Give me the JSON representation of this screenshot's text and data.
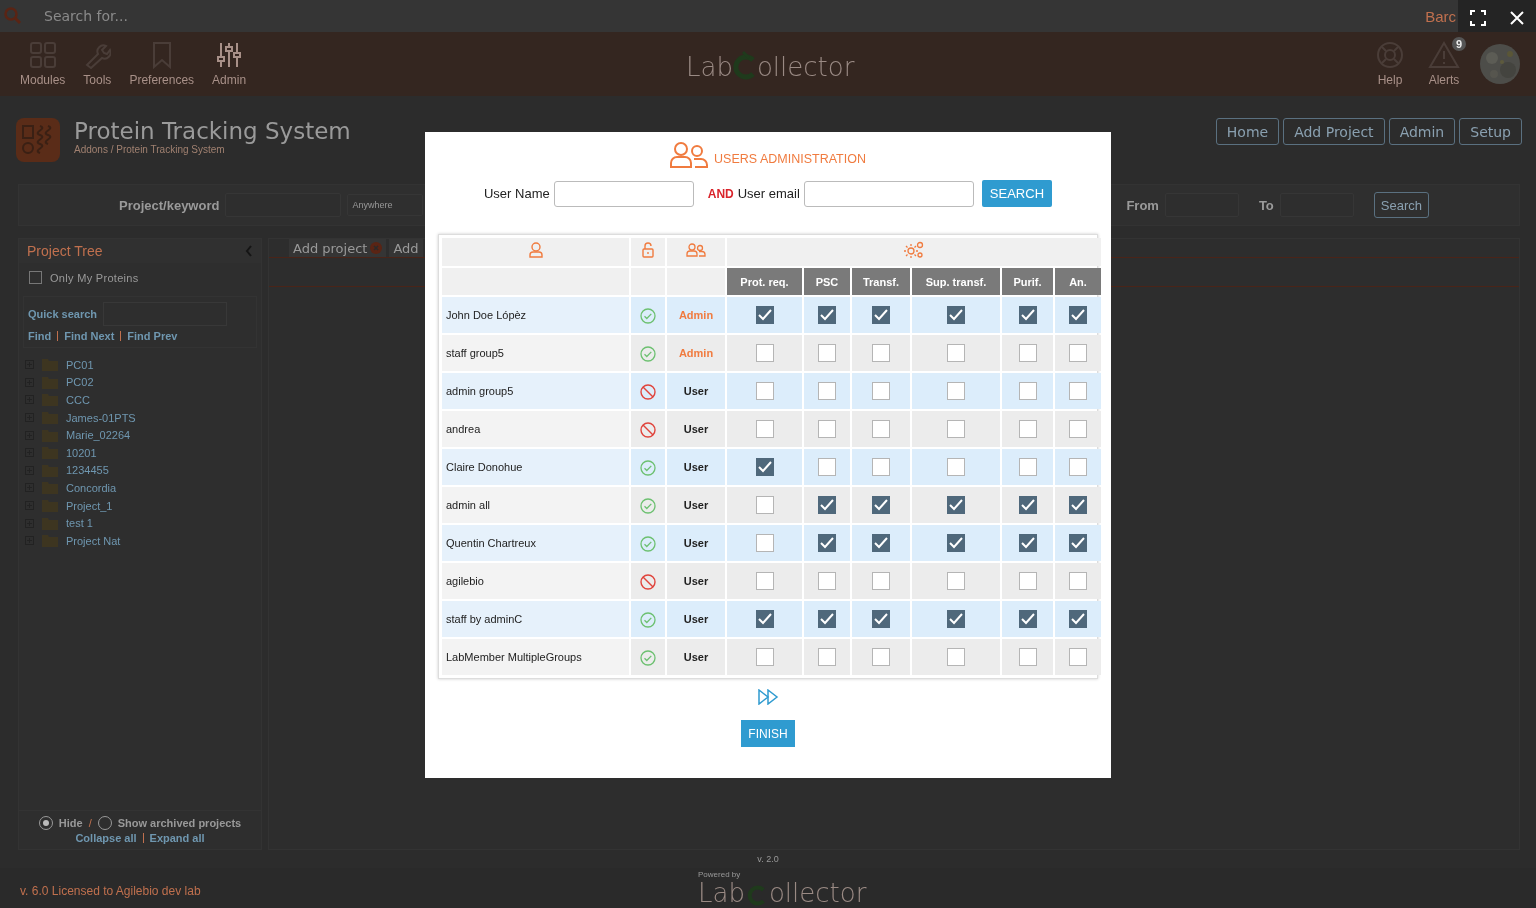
{
  "top_bar": {
    "search_placeholder": "Search for...",
    "barcode_label": "Barc"
  },
  "nav": [
    {
      "label": "Modules"
    },
    {
      "label": "Tools"
    },
    {
      "label": "Preferences"
    },
    {
      "label": "Admin"
    }
  ],
  "logo": {
    "left": "Lab",
    "right": "ollector"
  },
  "header_right": {
    "help": "Help",
    "alerts": "Alerts",
    "alert_count": "9"
  },
  "page": {
    "title": "Protein Tracking System",
    "breadcrumb": "Addons / Protein Tracking System"
  },
  "page_buttons": [
    "Home",
    "Add Project",
    "Admin",
    "Setup"
  ],
  "filter": {
    "keyword_label": "Project/keyword",
    "scope": "Anywhere",
    "from_label": "From",
    "to_label": "To",
    "search_button": "Search"
  },
  "project_tree": {
    "title": "Project Tree",
    "only_mine": {
      "label": "Only My Proteins",
      "checked": false
    },
    "quick_search_label": "Quick search",
    "find_links": [
      "Find",
      "Find Next",
      "Find Prev"
    ],
    "items": [
      {
        "label": "PC01",
        "expanded": false
      },
      {
        "label": "PC02",
        "expanded": false
      },
      {
        "label": "CCC",
        "expanded": false
      },
      {
        "label": "James-01PTS",
        "expanded": false
      },
      {
        "label": "Marie_02264",
        "expanded": false
      },
      {
        "label": "10201",
        "expanded": false
      },
      {
        "label": "1234455",
        "expanded": false
      },
      {
        "label": "Concordia",
        "expanded": false
      },
      {
        "label": "Project_1",
        "expanded": false
      },
      {
        "label": "test 1",
        "expanded": false
      },
      {
        "label": "Project Nat",
        "expanded": false
      }
    ]
  },
  "archived": {
    "options": [
      {
        "label": "Hide",
        "selected": true
      },
      {
        "label": "Show archived projects",
        "selected": false
      }
    ],
    "separator": "/",
    "links": [
      "Collapse all",
      "Expand all"
    ]
  },
  "tabs": [
    {
      "label": "Add project",
      "closable": true
    },
    {
      "label": "Add",
      "closable": false
    }
  ],
  "version": "v. 2.0",
  "footer": {
    "license": "v. 6.0 Licensed to Agilebio dev lab",
    "powered_by": "Powered by",
    "logo_left": "Lab",
    "logo_right": "ollector"
  },
  "modal": {
    "title": "USERS ADMINISTRATION",
    "user_name_label": "User Name",
    "and_label": "AND",
    "user_email_label": "User email",
    "search_button": "SEARCH",
    "columns": [
      "Prot. req.",
      "PSC",
      "Transf.",
      "Sup. transf.",
      "Purif.",
      "An."
    ],
    "rows": [
      {
        "name": "John Doe Lópèz",
        "active": true,
        "role": "Admin",
        "admin": true,
        "perms": [
          {
            "checked": true
          },
          {
            "checked": true
          },
          {
            "checked": true
          },
          {
            "checked": true
          },
          {
            "checked": true
          },
          {
            "checked": true
          }
        ]
      },
      {
        "name": "staff group5",
        "active": true,
        "role": "Admin",
        "admin": true,
        "perms": [
          {
            "checked": false
          },
          {
            "checked": false
          },
          {
            "checked": false
          },
          {
            "checked": false
          },
          {
            "checked": false
          },
          {
            "checked": false
          }
        ]
      },
      {
        "name": "admin group5",
        "active": false,
        "role": "User",
        "admin": false,
        "perms": [
          {
            "checked": false
          },
          {
            "checked": false
          },
          {
            "checked": false
          },
          {
            "checked": false
          },
          {
            "checked": false
          },
          {
            "checked": false
          }
        ]
      },
      {
        "name": "andrea",
        "active": false,
        "role": "User",
        "admin": false,
        "perms": [
          {
            "checked": false
          },
          {
            "checked": false
          },
          {
            "checked": false
          },
          {
            "checked": false
          },
          {
            "checked": false
          },
          {
            "checked": false
          }
        ]
      },
      {
        "name": "Claire Donohue",
        "active": true,
        "role": "User",
        "admin": false,
        "perms": [
          {
            "checked": true
          },
          {
            "checked": false
          },
          {
            "checked": false
          },
          {
            "checked": false
          },
          {
            "checked": false
          },
          {
            "checked": false
          }
        ]
      },
      {
        "name": "admin all",
        "active": true,
        "role": "User",
        "admin": false,
        "perms": [
          {
            "checked": false
          },
          {
            "checked": true
          },
          {
            "checked": true
          },
          {
            "checked": true
          },
          {
            "checked": true
          },
          {
            "checked": true
          }
        ]
      },
      {
        "name": "Quentin Chartreux",
        "active": true,
        "role": "User",
        "admin": false,
        "perms": [
          {
            "checked": false
          },
          {
            "checked": true
          },
          {
            "checked": true
          },
          {
            "checked": true
          },
          {
            "checked": true
          },
          {
            "checked": true
          }
        ]
      },
      {
        "name": "agilebio",
        "active": false,
        "role": "User",
        "admin": false,
        "perms": [
          {
            "checked": false
          },
          {
            "checked": false
          },
          {
            "checked": false
          },
          {
            "checked": false
          },
          {
            "checked": false
          },
          {
            "checked": false
          }
        ]
      },
      {
        "name": "staff by adminC",
        "active": true,
        "role": "User",
        "admin": false,
        "perms": [
          {
            "checked": true
          },
          {
            "checked": true
          },
          {
            "checked": true
          },
          {
            "checked": true
          },
          {
            "checked": true
          },
          {
            "checked": true
          }
        ]
      },
      {
        "name": "LabMember MultipleGroups",
        "active": true,
        "role": "User",
        "admin": false,
        "perms": [
          {
            "checked": false
          },
          {
            "checked": false
          },
          {
            "checked": false
          },
          {
            "checked": false
          },
          {
            "checked": false
          },
          {
            "checked": false
          }
        ]
      }
    ],
    "finish_button": "FINISH"
  }
}
